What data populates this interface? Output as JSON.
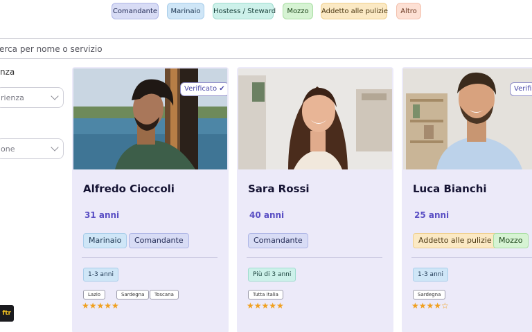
{
  "categories": [
    "Comandante",
    "Marinaio",
    "Hostess / Steward",
    "Mozzo",
    "Addetto alle pulizie",
    "Altro"
  ],
  "search": {
    "text": "erca per nome o servizio"
  },
  "filters": {
    "label": "nza",
    "select1": "rienza",
    "select2": "one"
  },
  "floating_button": {
    "label": "ftr"
  },
  "colors": {
    "card_bg": "#eceaf9",
    "accent": "#5a4fc4",
    "star": "#f0a020"
  },
  "cards": [
    {
      "name": "Alfredo Cioccoli",
      "age": "31 anni",
      "verified": "Verificato ✔",
      "roles": [
        "Marinaio",
        "Comandante"
      ],
      "experience": "1-3 anni",
      "regions": [
        "Lazio",
        "Sardegna",
        "Toscana"
      ],
      "rating": 5,
      "stars": "★★★★★"
    },
    {
      "name": "Sara Rossi",
      "age": "40 anni",
      "verified": "",
      "roles": [
        "Comandante"
      ],
      "experience": "Più di 3 anni",
      "regions": [
        "Tutta Italia"
      ],
      "rating": 5,
      "stars": "★★★★★"
    },
    {
      "name": "Luca Bianchi",
      "age": "25 anni",
      "verified": "Verifi",
      "roles": [
        "Addetto alle pulizie",
        "Mozzo"
      ],
      "experience": "1-3 anni",
      "regions": [
        "Sardegna"
      ],
      "rating": 4,
      "stars": "★★★★☆"
    }
  ]
}
